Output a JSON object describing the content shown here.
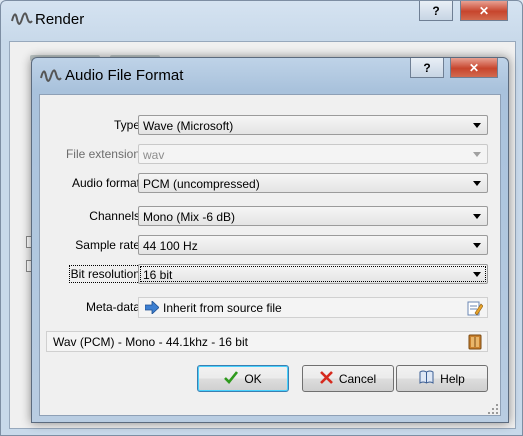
{
  "background_window": {
    "title": "Render",
    "help_glyph": "?",
    "close_glyph": "✕"
  },
  "dialog": {
    "title": "Audio File Format",
    "help_glyph": "?",
    "close_glyph": "✕",
    "fields": {
      "type": {
        "label": "Type",
        "value": "Wave (Microsoft)"
      },
      "file_extension": {
        "label": "File extension",
        "value": "wav"
      },
      "audio_format": {
        "label": "Audio format",
        "value": "PCM (uncompressed)"
      },
      "channels": {
        "label": "Channels",
        "value": "Mono (Mix -6 dB)"
      },
      "sample_rate": {
        "label": "Sample rate",
        "value": "44 100 Hz"
      },
      "bit_resolution": {
        "label": "Bit resolution",
        "value": "16 bit"
      },
      "meta_data": {
        "label": "Meta-data",
        "value": "Inherit from source file",
        "icon": "arrow-right-icon",
        "button_icon": "edit-metadata-icon"
      }
    },
    "summary": {
      "value": "Wav (PCM) - Mono - 44.1khz - 16 bit",
      "button_icon": "book-icon"
    },
    "buttons": {
      "ok": "OK",
      "cancel": "Cancel",
      "help": "Help"
    }
  },
  "colors": {
    "title_bar": "#bfd3e8",
    "close_button": "#c7452d",
    "ok_check": "#2f9a1e",
    "cancel_x": "#d62a1e",
    "default_button_border": "#3c7fb1"
  }
}
